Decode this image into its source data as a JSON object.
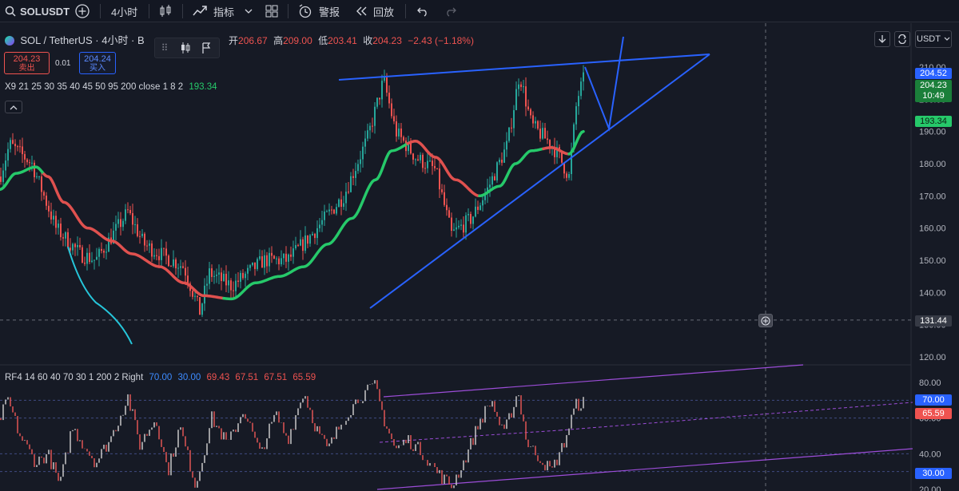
{
  "toolbar": {
    "symbol": "SOLUSDT",
    "interval": "4小时",
    "indicators_label": "指标",
    "alerts_label": "警报",
    "replay_label": "回放"
  },
  "legend": {
    "title": "SOL / TetherUS · 4小时 · B",
    "open_label": "开",
    "open": "206.67",
    "high_label": "高",
    "high": "209.00",
    "low_label": "低",
    "low": "203.41",
    "close_label": "收",
    "close": "204.23",
    "change": "−2.43 (−1.18%)",
    "sell_price": "204.23",
    "sell_label": "卖出",
    "spread": "0.01",
    "buy_price": "204.24",
    "buy_label": "买入",
    "ma_text": "X9 21 25 30 35 40 45 50 95 200 close 1 8 2",
    "ma_value": "193.34"
  },
  "rsi_legend": {
    "text": "RF4 14 60 40 70 30 1 200 2 Right",
    "v1": "70.00",
    "v2": "30.00",
    "v3": "69.43",
    "v4": "67.51",
    "v5": "67.51",
    "v6": "65.59"
  },
  "price_axis": {
    "currency": "USDT",
    "ticks": [
      "210.00",
      "200.00",
      "190.00",
      "180.00",
      "170.00",
      "160.00",
      "150.00",
      "140.00",
      "130.00",
      "120.00"
    ],
    "last_price": "204.23",
    "countdown": "10:49",
    "high_tag": "204.52",
    "ma_tag": "193.34",
    "crosshair_tag": "131.44"
  },
  "rsi_axis": {
    "ticks": [
      "80.00",
      "60.00",
      "40.00",
      "20.00"
    ],
    "tag_70": "70.00",
    "tag_rsi": "65.59",
    "tag_30": "30.00"
  },
  "colors": {
    "background": "#161a25",
    "trendline": "#2962ff",
    "ma_up": "#26c96a",
    "ma_down": "#e0514f",
    "up_candle": "#26a69a",
    "down_candle": "#ef5350",
    "channel": "#9c4dd8"
  }
}
